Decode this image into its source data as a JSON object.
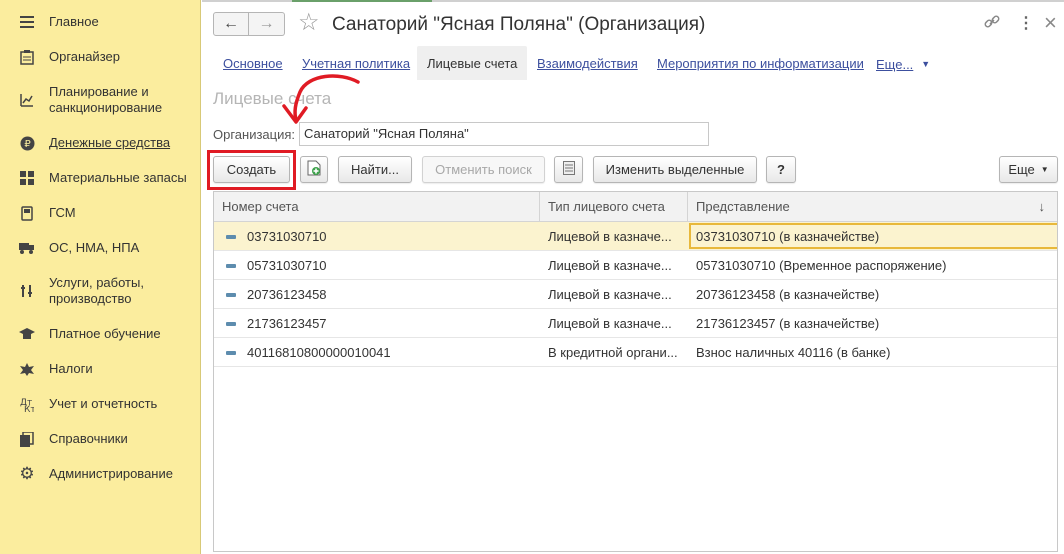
{
  "sidebar": {
    "items": [
      {
        "label": "Главное",
        "icon": "menu-icon"
      },
      {
        "label": "Органайзер",
        "icon": "organizer-icon"
      },
      {
        "label": "Планирование и\nсанкционирование",
        "icon": "planning-icon"
      },
      {
        "label": "Денежные средства",
        "icon": "money-icon"
      },
      {
        "label": "Материальные запасы",
        "icon": "inventory-icon"
      },
      {
        "label": "ГСМ",
        "icon": "fuel-icon"
      },
      {
        "label": "ОС, НМА, НПА",
        "icon": "truck-icon"
      },
      {
        "label": "Услуги, работы,\nпроизводство",
        "icon": "tools-icon"
      },
      {
        "label": "Платное обучение",
        "icon": "graduation-icon"
      },
      {
        "label": "Налоги",
        "icon": "tax-icon"
      },
      {
        "label": "Учет и отчетность",
        "icon": "accounting-icon"
      },
      {
        "label": "Справочники",
        "icon": "books-icon"
      },
      {
        "label": "Администрирование",
        "icon": "gear-icon"
      }
    ]
  },
  "header": {
    "title": "Санаторий \"Ясная Поляна\" (Организация)",
    "back_icon": "←",
    "forward_icon": "→",
    "star_icon": "☆",
    "link_icon": "🔗",
    "more_icon": "⋮",
    "close_icon": "×"
  },
  "tabs": {
    "main": "Основное",
    "policy": "Учетная политика",
    "accounts": "Лицевые счета",
    "interactions": "Взаимодействия",
    "it_events": "Мероприятия по информатизации",
    "more": "Еще..."
  },
  "section": {
    "title": "Лицевые счета"
  },
  "org": {
    "label": "Организация:",
    "value": "Санаторий \"Ясная Поляна\""
  },
  "toolbar": {
    "create": "Создать",
    "find": "Найти...",
    "cancel_search": "Отменить поиск",
    "change_selected": "Изменить выделенные",
    "help": "?",
    "more": "Еще"
  },
  "table": {
    "headers": [
      "Номер счета",
      "Тип лицевого счета",
      "Представление"
    ],
    "sort_indicator": "↓",
    "rows": [
      {
        "number": "03731030710",
        "type": "Лицевой в казначе...",
        "repr": "03731030710 (в казначействе)"
      },
      {
        "number": "05731030710",
        "type": "Лицевой в казначе...",
        "repr": "05731030710 (Временное распоряжение)"
      },
      {
        "number": "20736123458",
        "type": "Лицевой в казначе...",
        "repr": "20736123458 (в казначействе)"
      },
      {
        "number": "21736123457",
        "type": "Лицевой в казначе...",
        "repr": "21736123457 (в казначействе)"
      },
      {
        "number": "40116810800000010041",
        "type": "В кредитной органи...",
        "repr": "Взнос наличных 40116 (в банке)"
      }
    ]
  },
  "colors": {
    "sidebar_bg": "#fbed9e",
    "link": "#3c4f9e",
    "highlight": "#e01b24",
    "selected_row": "#fbf3cf",
    "focus_cell": "#e8b83a"
  }
}
